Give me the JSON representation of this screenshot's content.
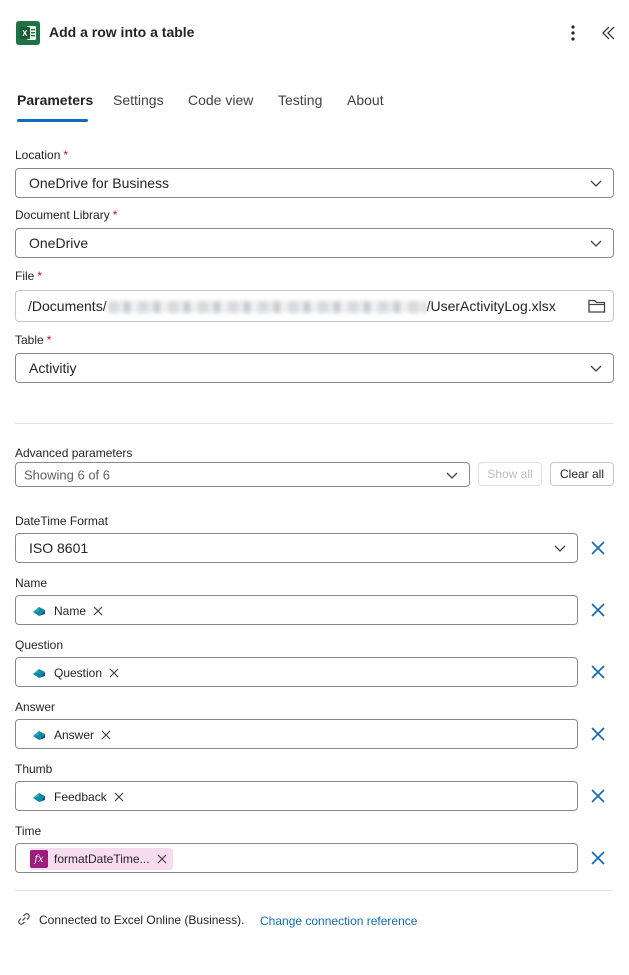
{
  "header": {
    "title": "Add a row into a table",
    "app_icon": "excel-icon",
    "more_icon": "more-vertical-icon",
    "collapse_icon": "collapse-panel-icon"
  },
  "tabs": [
    {
      "label": "Parameters",
      "active": true
    },
    {
      "label": "Settings",
      "active": false
    },
    {
      "label": "Code view",
      "active": false
    },
    {
      "label": "Testing",
      "active": false
    },
    {
      "label": "About",
      "active": false
    }
  ],
  "fields": {
    "location": {
      "label": "Location",
      "value": "OneDrive for Business",
      "required": "*"
    },
    "library": {
      "label": "Document Library",
      "value": "OneDrive",
      "required": "*"
    },
    "file": {
      "label": "File",
      "prefix": "/Documents/",
      "suffix": "/UserActivityLog.xlsx",
      "required": "*"
    },
    "table": {
      "label": "Table",
      "value": "Activitiy",
      "required": "*"
    }
  },
  "advanced": {
    "label": "Advanced parameters",
    "value": "Showing 6 of 6",
    "show_all": "Show all",
    "clear_all": "Clear all"
  },
  "params": {
    "datetime": {
      "label": "DateTime Format",
      "value": "ISO 8601"
    },
    "name": {
      "label": "Name",
      "token": "Name"
    },
    "question": {
      "label": "Question",
      "token": "Question"
    },
    "answer": {
      "label": "Answer",
      "token": "Answer"
    },
    "thumb": {
      "label": "Thumb",
      "token": "Feedback"
    },
    "time": {
      "label": "Time",
      "token": "formatDateTime...",
      "token_icon": "fx"
    }
  },
  "footer": {
    "connection": "Connected to Excel Online (Business).",
    "change_link": "Change connection reference"
  },
  "colors": {
    "accent": "#0f6cbd",
    "excel_green": "#1f7244",
    "expression_token": "#9b1d7c",
    "required": "#c50f1f"
  }
}
